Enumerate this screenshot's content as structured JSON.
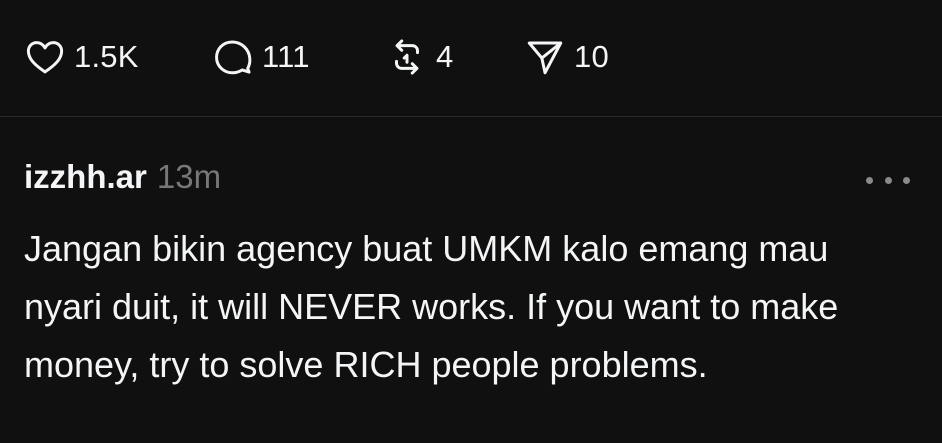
{
  "actions": {
    "like": {
      "icon": "heart-icon",
      "count": "1.5K"
    },
    "comment": {
      "icon": "comment-icon",
      "count": "111"
    },
    "repost": {
      "icon": "repost-icon",
      "count": "4"
    },
    "share": {
      "icon": "send-icon",
      "count": "10"
    }
  },
  "post": {
    "username": "izzhh.ar",
    "timestamp": "13m",
    "more_icon": "more-horizontal-icon",
    "text": "Jangan bikin agency buat UMKM kalo emang mau nyari duit, it will NEVER works. If you want to make money, try to solve RICH people problems."
  },
  "colors": {
    "background": "#101010",
    "text": "#f3f5f7",
    "muted": "#777777",
    "divider": "#2a2a2a"
  }
}
